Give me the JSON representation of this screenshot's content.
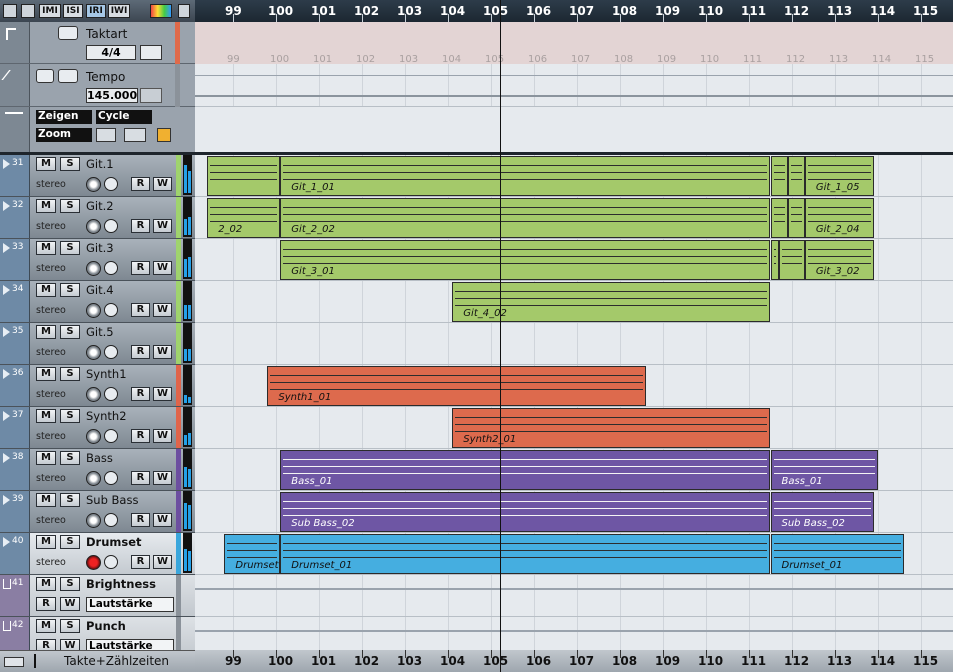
{
  "toolbar": {
    "buttons": [
      "IMI",
      "ISI",
      "IRI",
      "IWI"
    ]
  },
  "global": {
    "signature": {
      "label": "Taktart",
      "value": "4/4"
    },
    "tempo": {
      "label": "Tempo",
      "value": "145.000"
    },
    "zoom": {
      "show_label": "Zeigen",
      "cycle_label": "Cycle",
      "zoom_label": "Zoom"
    }
  },
  "ruler": {
    "bars": [
      "99",
      "100",
      "101",
      "102",
      "103",
      "104",
      "105",
      "106",
      "107",
      "108",
      "109",
      "110",
      "111",
      "112",
      "113",
      "114",
      "115"
    ]
  },
  "tracks": [
    {
      "num": "31",
      "name": "Git.1",
      "mode": "stereo",
      "color": "#9fd36d"
    },
    {
      "num": "32",
      "name": "Git.2",
      "mode": "stereo",
      "color": "#9fd36d"
    },
    {
      "num": "33",
      "name": "Git.3",
      "mode": "stereo",
      "color": "#9fd36d"
    },
    {
      "num": "34",
      "name": "Git.4",
      "mode": "stereo",
      "color": "#9fd36d"
    },
    {
      "num": "35",
      "name": "Git.5",
      "mode": "stereo",
      "color": "#9fd36d"
    },
    {
      "num": "36",
      "name": "Synth1",
      "mode": "stereo",
      "color": "#e0644a"
    },
    {
      "num": "37",
      "name": "Synth2",
      "mode": "stereo",
      "color": "#e0644a"
    },
    {
      "num": "38",
      "name": "Bass",
      "mode": "stereo",
      "color": "#6c4ea0"
    },
    {
      "num": "39",
      "name": "Sub Bass",
      "mode": "stereo",
      "color": "#6c4ea0"
    },
    {
      "num": "40",
      "name": "Drumset",
      "mode": "stereo",
      "color": "#3aa6dc"
    }
  ],
  "fx_tracks": [
    {
      "num": "41",
      "name": "Brightness",
      "param": "Lautstärke"
    },
    {
      "num": "42",
      "name": "Punch",
      "param": "Lautstärke"
    }
  ],
  "buttons": {
    "mute": "M",
    "solo": "S",
    "read": "R",
    "write": "W"
  },
  "footer": {
    "timebase": "Takte+Zählzeiten"
  },
  "parts": [
    {
      "lane": 0,
      "label": "",
      "color": "#a4c96a",
      "x0": 98.4,
      "x1": 100.1
    },
    {
      "lane": 0,
      "label": "Git_1_01",
      "color": "#a4c96a",
      "x0": 100.1,
      "x1": 111.5
    },
    {
      "lane": 0,
      "label": "",
      "color": "#a4c96a",
      "x0": 111.5,
      "x1": 111.9
    },
    {
      "lane": 0,
      "label": "",
      "color": "#a4c96a",
      "x0": 111.9,
      "x1": 112.3
    },
    {
      "lane": 0,
      "label": "Git_1_05",
      "color": "#a4c96a",
      "x0": 112.3,
      "x1": 113.9
    },
    {
      "lane": 1,
      "label": "2_02",
      "color": "#a4c96a",
      "x0": 98.4,
      "x1": 100.1
    },
    {
      "lane": 1,
      "label": "Git_2_02",
      "color": "#a4c96a",
      "x0": 100.1,
      "x1": 111.5
    },
    {
      "lane": 1,
      "label": "",
      "color": "#a4c96a",
      "x0": 111.5,
      "x1": 111.9
    },
    {
      "lane": 1,
      "label": "",
      "color": "#a4c96a",
      "x0": 111.9,
      "x1": 112.3
    },
    {
      "lane": 1,
      "label": "Git_2_04",
      "color": "#a4c96a",
      "x0": 112.3,
      "x1": 113.9
    },
    {
      "lane": 2,
      "label": "Git_3_01",
      "color": "#a4c96a",
      "x0": 100.1,
      "x1": 111.5
    },
    {
      "lane": 2,
      "label": "",
      "color": "#a4c96a",
      "x0": 111.5,
      "x1": 111.7
    },
    {
      "lane": 2,
      "label": "",
      "color": "#a4c96a",
      "x0": 111.7,
      "x1": 112.3
    },
    {
      "lane": 2,
      "label": "Git_3_02",
      "color": "#a4c96a",
      "x0": 112.3,
      "x1": 113.9
    },
    {
      "lane": 3,
      "label": "Git_4_02",
      "color": "#a4c96a",
      "x0": 104.1,
      "x1": 111.5
    },
    {
      "lane": 5,
      "label": "Synth1_01",
      "color": "#dd6a4d",
      "x0": 99.8,
      "x1": 108.6
    },
    {
      "lane": 6,
      "label": "Synth2_01",
      "color": "#dd6a4d",
      "x0": 104.1,
      "x1": 111.5
    },
    {
      "lane": 7,
      "label": "Bass_01",
      "color": "#6e56a4",
      "x0": 100.1,
      "x1": 111.5
    },
    {
      "lane": 7,
      "label": "Bass_01",
      "color": "#6e56a4",
      "x0": 111.5,
      "x1": 114.0
    },
    {
      "lane": 8,
      "label": "Sub Bass_02",
      "color": "#6e56a4",
      "x0": 100.1,
      "x1": 111.5
    },
    {
      "lane": 8,
      "label": "Sub Bass_02",
      "color": "#6e56a4",
      "x0": 111.5,
      "x1": 113.9
    },
    {
      "lane": 9,
      "label": "Drumset",
      "color": "#45aee0",
      "x0": 98.8,
      "x1": 100.1
    },
    {
      "lane": 9,
      "label": "Drumset_01",
      "color": "#45aee0",
      "x0": 100.1,
      "x1": 111.5
    },
    {
      "lane": 9,
      "label": "Drumset_01",
      "color": "#45aee0",
      "x0": 111.5,
      "x1": 114.6
    }
  ],
  "cursor_bar": 105.2
}
